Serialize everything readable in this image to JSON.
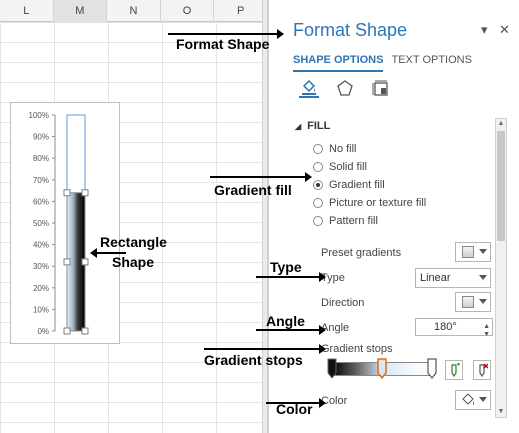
{
  "sheet": {
    "columns": [
      "L",
      "M",
      "N",
      "O",
      "P"
    ],
    "selected_column": "M"
  },
  "chart_data": {
    "type": "bar",
    "y_ticks": [
      "100%",
      "90%",
      "80%",
      "70%",
      "60%",
      "50%",
      "40%",
      "30%",
      "20%",
      "10%",
      "0%"
    ],
    "ylim": [
      0,
      1
    ],
    "series": [
      {
        "values": [
          0.64
        ],
        "fill": "gradient"
      },
      {
        "values": [
          1.0
        ],
        "fill": "none",
        "outline": "#5b9bd5"
      }
    ]
  },
  "annotations": {
    "format_shape": "Format Shape",
    "gradient_fill": "Gradient fill",
    "rectangle_shape_line1": "Rectangle",
    "rectangle_shape_line2": "Shape",
    "type": "Type",
    "angle": "Angle",
    "gradient_stops": "Gradient stops",
    "color": "Color"
  },
  "pane": {
    "title": "Format Shape",
    "dropdown_glyph": "▾",
    "close_glyph": "✕",
    "tabs": [
      {
        "label": "SHAPE OPTIONS",
        "active": true
      },
      {
        "label": "TEXT OPTIONS",
        "active": false
      }
    ],
    "section": "FILL",
    "fill_options": [
      {
        "label": "No fill",
        "selected": false
      },
      {
        "label": "Solid fill",
        "selected": false
      },
      {
        "label": "Gradient fill",
        "selected": true
      },
      {
        "label": "Picture or texture fill",
        "selected": false
      },
      {
        "label": "Pattern fill",
        "selected": false
      }
    ],
    "preset_gradients_label": "Preset gradients",
    "type_label": "Type",
    "type_value": "Linear",
    "direction_label": "Direction",
    "angle_label": "Angle",
    "angle_value": "180°",
    "gradient_stops_label": "Gradient stops",
    "color_label": "Color",
    "accent": "#2e75b6"
  }
}
